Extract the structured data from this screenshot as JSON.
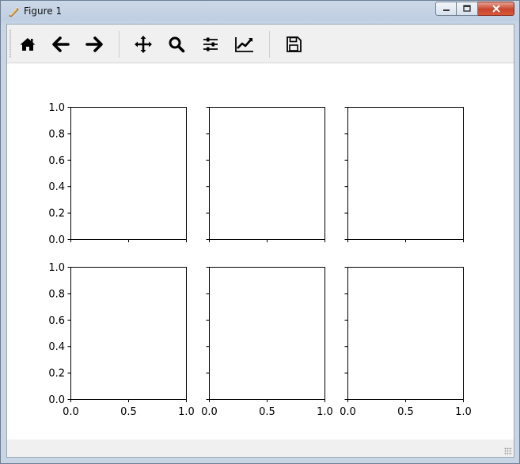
{
  "window": {
    "title": "Figure 1"
  },
  "toolbar": {
    "buttons": [
      {
        "icon": "home-icon"
      },
      {
        "icon": "arrow-left-icon"
      },
      {
        "icon": "arrow-right-icon"
      },
      {
        "icon": "move-icon"
      },
      {
        "icon": "zoom-icon"
      },
      {
        "icon": "sliders-icon"
      },
      {
        "icon": "line-chart-icon"
      },
      {
        "icon": "save-icon"
      }
    ]
  },
  "chart_data": {
    "type": "line",
    "layout": "2x3 subplots, shared x and y axes",
    "xlim": [
      0.0,
      1.0
    ],
    "ylim": [
      0.0,
      1.0
    ],
    "xticks": [
      "0.0",
      "0.5",
      "1.0"
    ],
    "yticks": [
      "0.0",
      "0.2",
      "0.4",
      "0.6",
      "0.8",
      "1.0"
    ],
    "series": [],
    "grid": false
  }
}
